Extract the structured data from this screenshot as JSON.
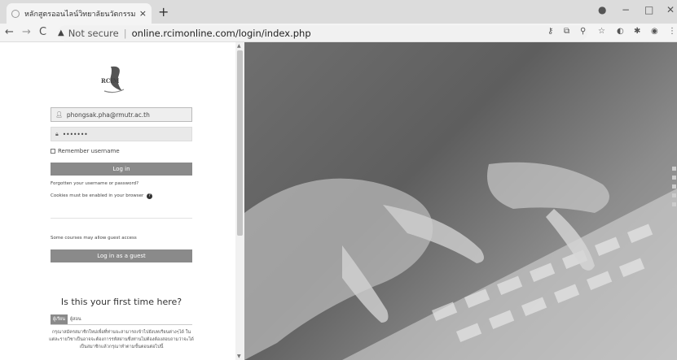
{
  "browser": {
    "tab_title": "หลักสูตรออนไลน์วิทยาลัยนวัตกรรมการ",
    "tab_close": "×",
    "new_tab": "+",
    "security_label": "Not secure",
    "separator": "|",
    "url": "online.rcimonline.com/login/index.php",
    "back": "←",
    "forward": "→",
    "reload": "C"
  },
  "login": {
    "logo_text": "RCIM",
    "username_value": "phongsak.pha@rmutr.ac.th",
    "password_value": "•••••••",
    "remember_label": "Remember username",
    "login_button": "Log in",
    "forgotten_link": "Forgotten your username or password?",
    "cookies_text": "Cookies must be enabled in your browser",
    "guest_text": "Some courses may allow guest access",
    "guest_button": "Log in as a guest"
  },
  "first_time": {
    "heading": "Is this your first time here?",
    "tabs": [
      "ผู้เรียน",
      "ผู้สอน"
    ],
    "description": "กรุณาสมัครสมาชิกใหม่เพื่อที่ท่านจะสามารถเข้าไปยังบทเรียนต่างๆได้ ในแต่ละรายวิชาเป็นอาจจะต้องการรหัสผ่านซึ่งท่านไม่ต้องต้องสอบถามว่าจะได้เป็นสมาชิกแล้วกรุณาทำตามขั้นตอนต่อไปนี้"
  },
  "colors": {
    "button_gray": "#8a8a8a",
    "field_bg": "#e9e9e9"
  }
}
